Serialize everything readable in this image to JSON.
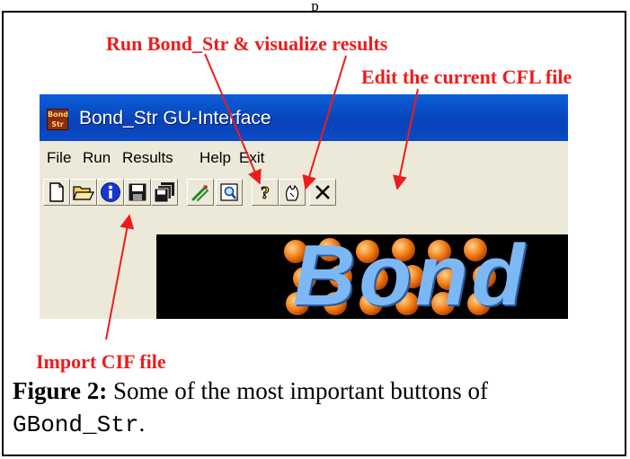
{
  "top_label": "p",
  "callouts": {
    "run": "Run Bond_Str & visualize results",
    "edit": "Edit the current CFL file",
    "import": "Import CIF file"
  },
  "window": {
    "icon_text": "Bond Str",
    "title": "Bond_Str GU-Interface",
    "menu": [
      "File",
      "Run",
      "Results",
      "Help",
      "Exit"
    ],
    "toolbar_icons": [
      "new-file-icon",
      "open-folder-icon",
      "info-icon",
      "save-icon",
      "save-all-icon",
      "run-icon",
      "visualize-icon",
      "help-icon",
      "edit-cfl-icon",
      "close-icon"
    ],
    "banner_text": "Bond"
  },
  "caption": {
    "label": "Figure 2:",
    "text": " Some of the most important buttons of ",
    "code": "GBond_Str",
    "end": "."
  },
  "colors": {
    "callout": "#ee1c1c",
    "titlebar": "#0a5fd8",
    "banner_text": "#7db8f6"
  }
}
